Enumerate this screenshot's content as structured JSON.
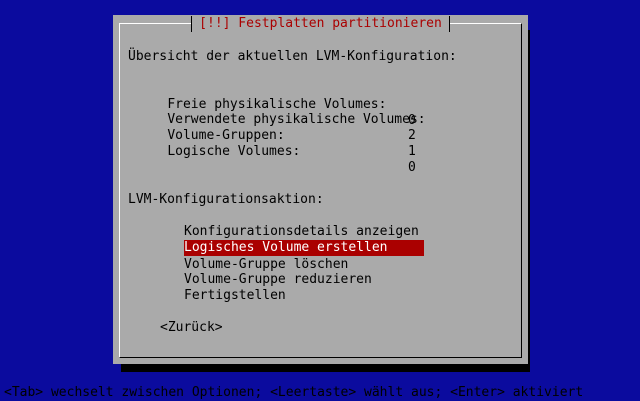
{
  "dialog": {
    "title": "[!!] Festplatten partitionieren",
    "overview_heading": "Übersicht der aktuellen LVM-Konfiguration:",
    "stats": [
      {
        "label": "Freie physikalische Volumes:",
        "value": "0"
      },
      {
        "label": "Verwendete physikalische Volumes:",
        "value": "2"
      },
      {
        "label": "Volume-Gruppen:",
        "value": "1"
      },
      {
        "label": "Logische Volumes:",
        "value": "0"
      }
    ],
    "action_heading": "LVM-Konfigurationsaktion:",
    "menu_items": [
      {
        "label": "Konfigurationsdetails anzeigen"
      },
      {
        "label": "Logisches Volume erstellen"
      },
      {
        "label": "Volume-Gruppe löschen"
      },
      {
        "label": "Volume-Gruppe reduzieren"
      },
      {
        "label": "Fertigstellen"
      }
    ],
    "selected_index": 1,
    "back_button": "<Zurück>"
  },
  "status_bar": "<Tab> wechselt zwischen Optionen; <Leertaste> wählt aus; <Enter> aktiviert",
  "colors": {
    "background": "#0b0b9e",
    "dialog": "#aaaaaa",
    "accent": "#aa0000"
  }
}
